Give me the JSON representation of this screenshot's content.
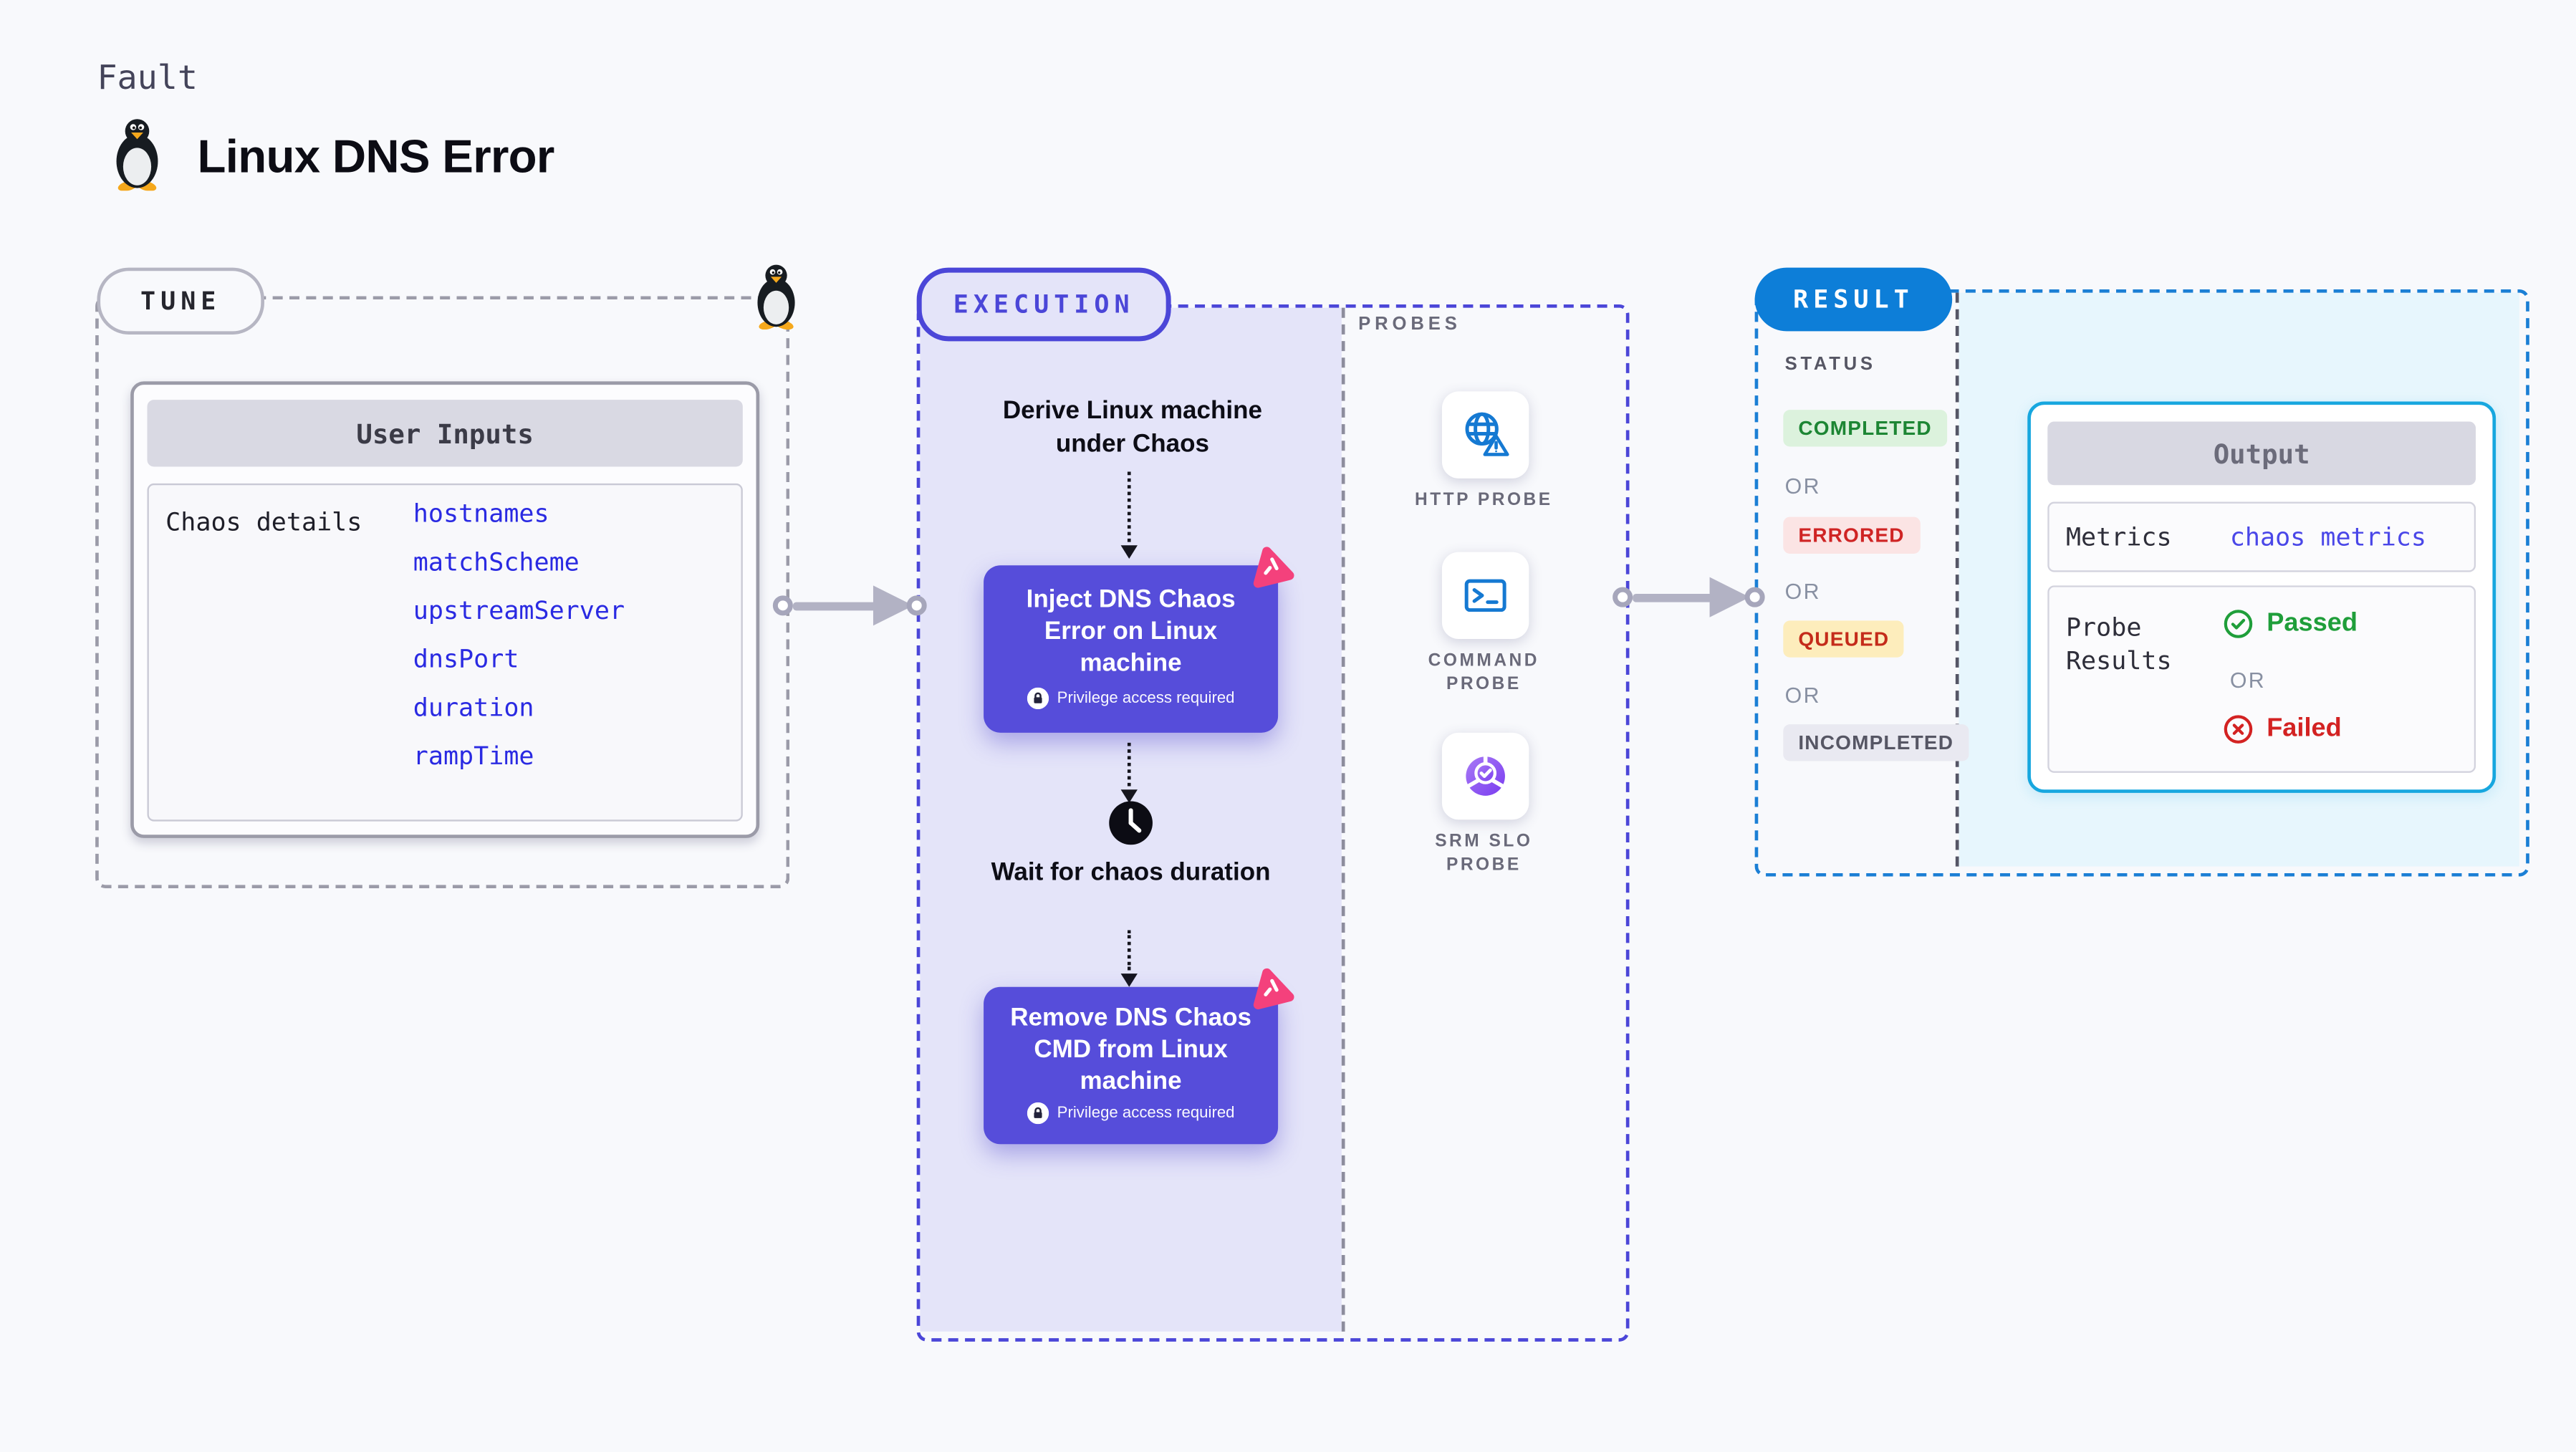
{
  "page": {
    "kind_label": "Fault",
    "title": "Linux DNS Error"
  },
  "tune": {
    "badge": "TUNE",
    "card_header": "User Inputs",
    "row_label": "Chaos details",
    "inputs": [
      "hostnames",
      "matchScheme",
      "upstreamServer",
      "dnsPort",
      "duration",
      "rampTime"
    ]
  },
  "execution": {
    "badge": "EXECUTION",
    "step_derive": "Derive Linux machine under Chaos",
    "card_inject": "Inject DNS Chaos Error on Linux machine",
    "step_wait": "Wait for chaos duration",
    "card_remove": "Remove DNS Chaos CMD from Linux machine",
    "privilege_note": "Privilege access required"
  },
  "probes": {
    "label": "PROBES",
    "items": [
      {
        "name": "HTTP PROBE",
        "icon": "globe-alert-icon"
      },
      {
        "name": "COMMAND PROBE",
        "icon": "terminal-icon"
      },
      {
        "name": "SRM SLO PROBE",
        "icon": "slo-donut-icon"
      }
    ]
  },
  "result": {
    "badge": "RESULT",
    "status_label": "STATUS",
    "or_label": "OR",
    "statuses": [
      {
        "label": "COMPLETED",
        "fg": "#1d8634",
        "bg": "#dcf2dd"
      },
      {
        "label": "ERRORED",
        "fg": "#cf2424",
        "bg": "#fbe4e4"
      },
      {
        "label": "QUEUED",
        "fg": "#c42b1a",
        "bg": "#fdedbc"
      },
      {
        "label": "INCOMPLETED",
        "fg": "#565664",
        "bg": "#e9e9f1"
      }
    ],
    "output": {
      "header": "Output",
      "metrics_label": "Metrics",
      "metrics_link": "chaos metrics",
      "probe_results_label": "Probe Results",
      "or_label": "OR",
      "passed_label": "Passed",
      "failed_label": "Failed"
    }
  },
  "colors": {
    "accent_indigo": "#4b46d8",
    "lavender_bg": "#e4e4f9",
    "step_card_purple": "#564dda",
    "chaos_pink": "#f4417c",
    "probe_icon_blue": "#1579d2",
    "srm_purple": "#8b5cf2",
    "result_blue": "#0d7ed8",
    "output_border_cyan": "#17a7df",
    "result_panel_bg": "#e7f6fd",
    "passed_green": "#1f9e3a",
    "failed_red": "#d32222",
    "link_blue": "#2a2ae2"
  }
}
